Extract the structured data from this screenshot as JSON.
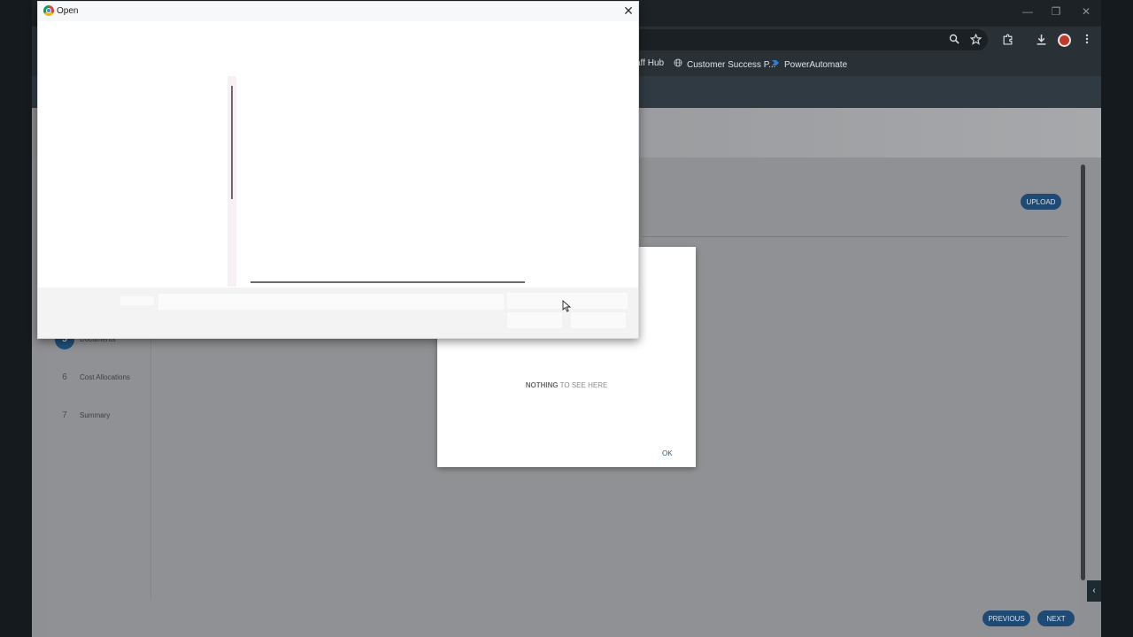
{
  "browser": {
    "window_controls": {
      "minimize": "—",
      "restore": "❐",
      "close": "✕"
    },
    "bookmarks": [
      {
        "label": "aff Hub",
        "icon": "none"
      },
      {
        "label": "Customer Success P...",
        "icon": "globe-icon"
      },
      {
        "label": "PowerAutomate",
        "icon": "power-automate-icon"
      }
    ]
  },
  "page": {
    "upload_label": "UPLOAD",
    "steps": [
      {
        "num": "5",
        "label": "Documents",
        "active": true
      },
      {
        "num": "6",
        "label": "Cost Allocations",
        "active": false
      },
      {
        "num": "7",
        "label": "Summary",
        "active": false
      }
    ],
    "previous_label": "PREVIOUS",
    "next_label": "NEXT"
  },
  "empty_dialog": {
    "message_bold": "NOTHING",
    "message_rest": " TO SEE HERE",
    "ok_label": "OK"
  },
  "open_dialog": {
    "title": "Open",
    "close_glyph": "✕"
  },
  "colors": {
    "accent": "#1e4a73",
    "page_overlay": "#8f9093",
    "dialog_bg": "#ffffff"
  }
}
